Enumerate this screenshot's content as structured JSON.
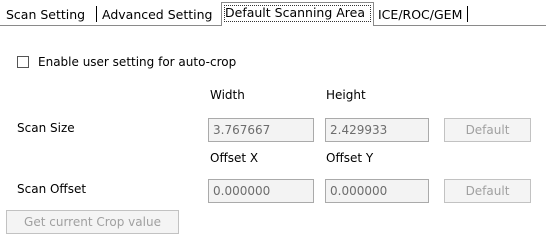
{
  "tabs": [
    {
      "label": "Scan Setting"
    },
    {
      "label": "Advanced Setting"
    },
    {
      "label": "Default Scanning Area",
      "active": true
    },
    {
      "label": "ICE/ROC/GEM"
    }
  ],
  "autocrop": {
    "label": "Enable user setting for auto-crop",
    "checked": false
  },
  "size": {
    "width_header": "Width",
    "height_header": "Height",
    "row_label": "Scan Size",
    "width_value": "3.767667",
    "height_value": "2.429933",
    "default_label": "Default"
  },
  "offset": {
    "x_header": "Offset  X",
    "y_header": "Offset  Y",
    "row_label": "Scan Offset",
    "x_value": "0.000000",
    "y_value": "0.000000",
    "default_label": "Default"
  },
  "crop_button_label": "Get current Crop value",
  "colors": {
    "disabled_text": "#a0a0a0",
    "field_text": "#6d6d6d",
    "field_bg": "#f3f3f3"
  }
}
